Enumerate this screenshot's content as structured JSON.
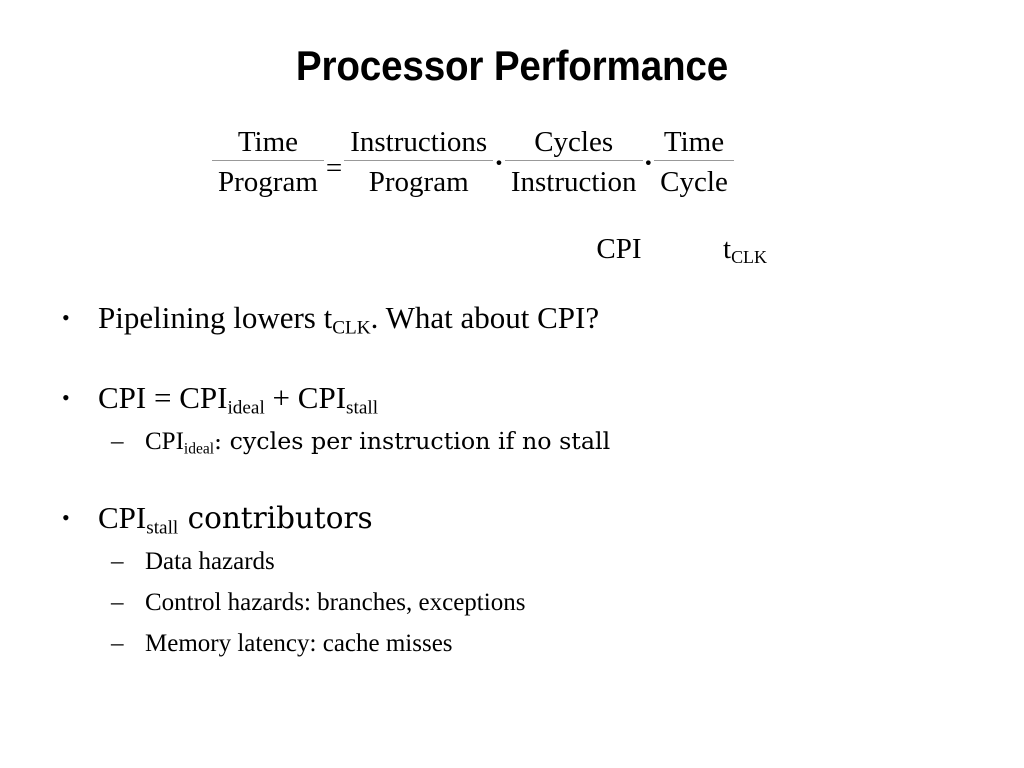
{
  "slide": {
    "title": "Processor Performance",
    "background_color": "#ffffff",
    "text_color": "#000000",
    "rule_color": "#999999"
  },
  "equation": {
    "fractions": [
      {
        "numerator": "Time",
        "denominator": "Program",
        "annotation": ""
      },
      {
        "numerator": "Instructions",
        "denominator": "Program",
        "annotation": ""
      },
      {
        "numerator": "Cycles",
        "denominator": "Instruction",
        "annotation": "CPI"
      },
      {
        "numerator": "Time",
        "denominator": "Cycle",
        "annotation": "t_CLK"
      }
    ],
    "operators": {
      "equals": "=",
      "multiply": "·"
    },
    "annotations": {
      "cpi": "CPI",
      "tclk_base": "t",
      "tclk_sub": "CLK"
    }
  },
  "bullets": [
    {
      "marker": "•",
      "parts": [
        {
          "text": "Pipelining lowers t"
        },
        {
          "sub": "CLK"
        },
        {
          "text": ". What about CPI?"
        }
      ],
      "children": []
    },
    {
      "marker": "•",
      "parts": [
        {
          "text": "CPI = CPI"
        },
        {
          "sub": "ideal"
        },
        {
          "text": " + CPI"
        },
        {
          "sub": "stall"
        }
      ],
      "children": [
        {
          "marker": "–",
          "parts": [
            {
              "text": "CPI"
            },
            {
              "sub": "ideal"
            },
            {
              "text": ": cycles per instruction if no stall"
            }
          ]
        }
      ]
    },
    {
      "marker": "•",
      "parts": [
        {
          "text": "CPI"
        },
        {
          "sub": "stall"
        },
        {
          "text": " contributors"
        }
      ],
      "children": [
        {
          "marker": "–",
          "parts": [
            {
              "text": "Data hazards"
            }
          ]
        },
        {
          "marker": "–",
          "parts": [
            {
              "text": "Control hazards: branches, exceptions"
            }
          ]
        },
        {
          "marker": "–",
          "parts": [
            {
              "text": "Memory latency: cache misses"
            }
          ]
        }
      ]
    }
  ]
}
